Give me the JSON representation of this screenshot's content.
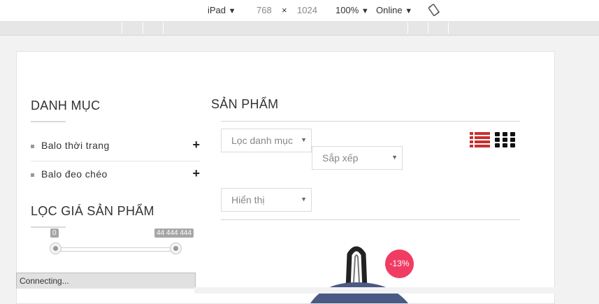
{
  "devtools": {
    "device": "iPad",
    "width": "768",
    "times": "×",
    "height": "1024",
    "zoom": "100%",
    "network": "Online",
    "dropdown_glyph": "▼"
  },
  "sidebar": {
    "category_title": "DANH MỤC",
    "categories": [
      {
        "label": "Balo thời trang",
        "expand": "+"
      },
      {
        "label": "Balo đeo chéo",
        "expand": "+"
      }
    ],
    "price_filter_title": "LỌC GIÁ SẢN PHẨM",
    "price_min_label": "0",
    "price_max_label": "44 444 444",
    "price_min_value": 0,
    "price_max_value": 44444444
  },
  "main": {
    "title": "SẢN PHẨM",
    "filter_category": "Lọc danh mục",
    "sort": "Sắp xếp",
    "display": "Hiển thị",
    "view_list_color": "#c9302c",
    "view_grid_color": "#111111",
    "discount_badge": "-13%",
    "badge_color": "#f03c63"
  },
  "status_bar": {
    "text": "Connecting..."
  }
}
